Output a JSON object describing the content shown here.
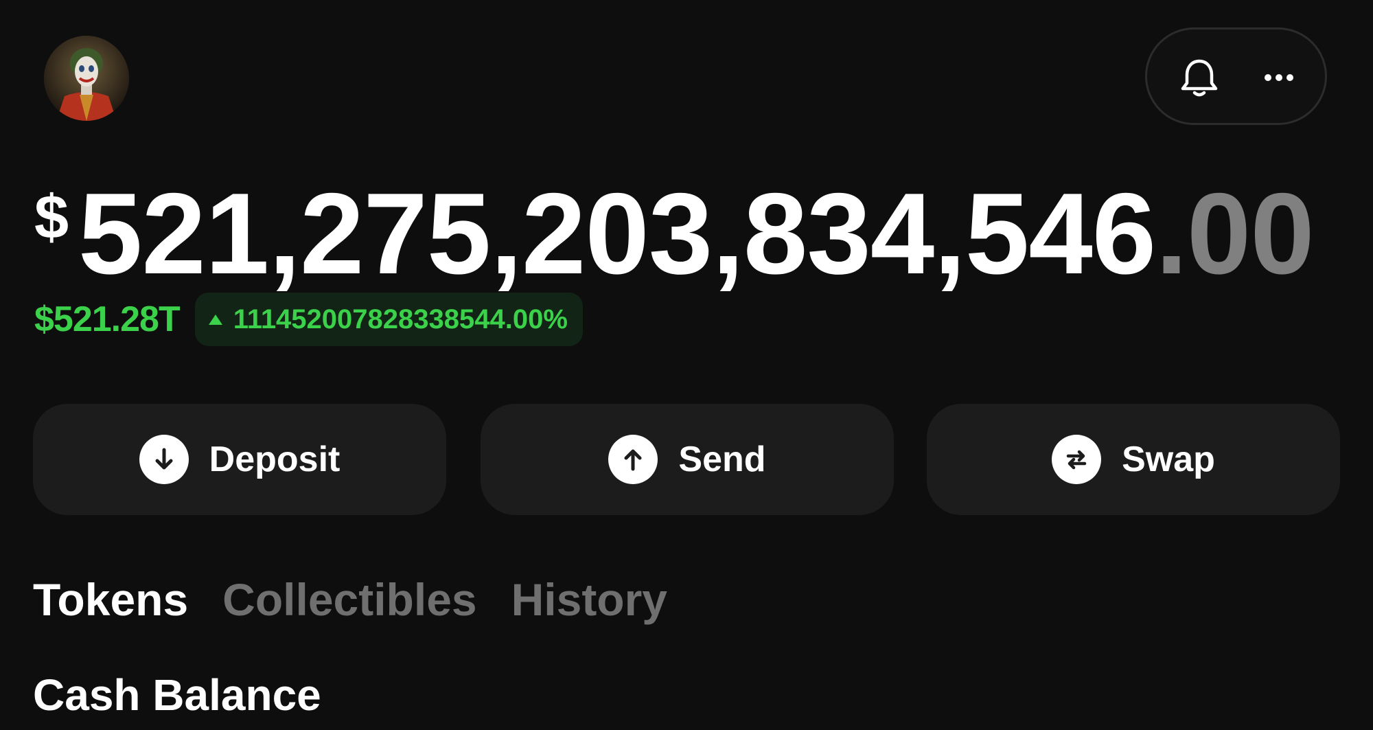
{
  "header": {
    "avatar_alt": "profile avatar",
    "notification_icon": "bell-icon",
    "more_icon": "more-icon"
  },
  "balance": {
    "currency_symbol": "$",
    "integer_part": "521,275,203,834,546",
    "fraction_part": ".00",
    "short_value": "$521.28T",
    "change_percent": "111452007828338544.00%",
    "change_direction": "up"
  },
  "actions": {
    "deposit": {
      "label": "Deposit",
      "icon": "arrow-down-circle-icon"
    },
    "send": {
      "label": "Send",
      "icon": "arrow-up-circle-icon"
    },
    "swap": {
      "label": "Swap",
      "icon": "swap-circle-icon"
    }
  },
  "tabs": [
    {
      "label": "Tokens",
      "active": true
    },
    {
      "label": "Collectibles",
      "active": false
    },
    {
      "label": "History",
      "active": false
    }
  ],
  "section": {
    "title": "Cash Balance"
  },
  "colors": {
    "background": "#0e0e0e",
    "positive": "#3cd14a",
    "button_bg": "#1c1c1c",
    "muted_text": "#6f6f6f"
  }
}
